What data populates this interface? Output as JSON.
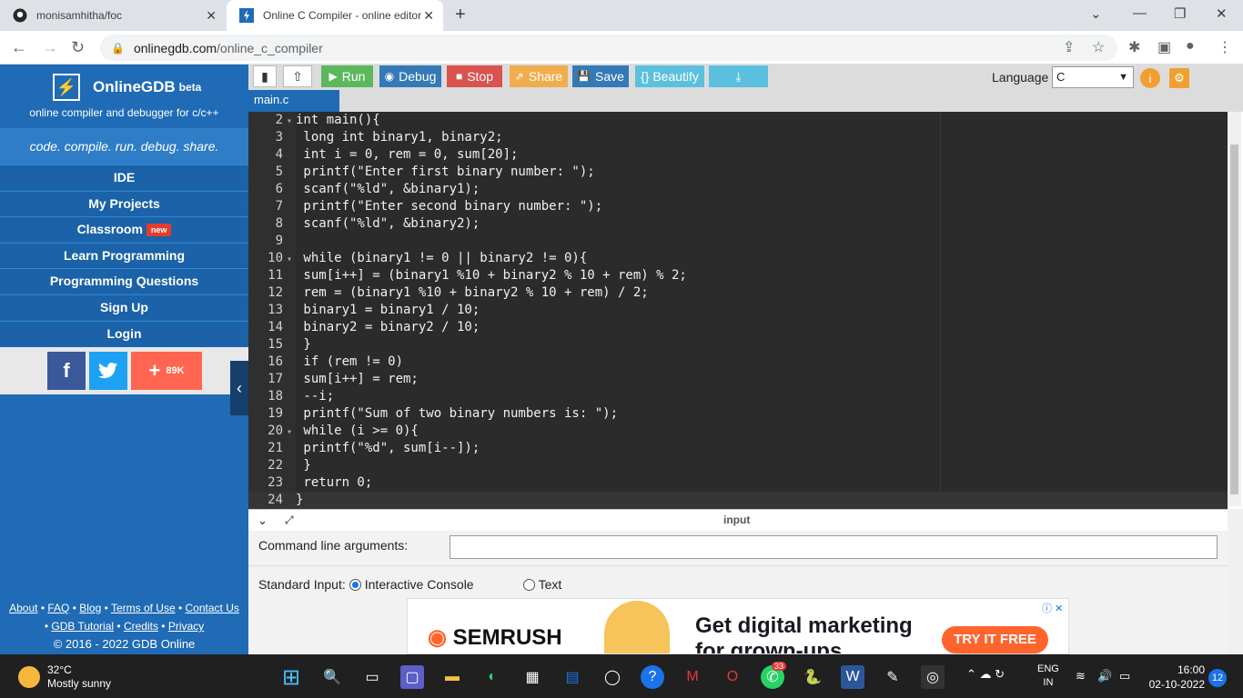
{
  "browser": {
    "tabs": [
      {
        "title": "monisamhitha/foc",
        "icon": "github-icon"
      },
      {
        "title": "Online C Compiler - online editor",
        "icon": "onlinegdb-icon"
      }
    ],
    "address": {
      "domain": "onlinegdb.com",
      "path": "/online_c_compiler"
    }
  },
  "sidebar": {
    "logo_name": "OnlineGDB",
    "logo_sup": "beta",
    "subtitle": "online compiler and debugger for c/c++",
    "tagline": "code. compile. run. debug. share.",
    "nav": [
      {
        "label": "IDE"
      },
      {
        "label": "My Projects"
      },
      {
        "label": "Classroom",
        "badge": "new"
      },
      {
        "label": "Learn Programming"
      },
      {
        "label": "Programming Questions"
      },
      {
        "label": "Sign Up"
      },
      {
        "label": "Login"
      }
    ],
    "social": {
      "facebook": "f",
      "twitter": "t",
      "share_count": "89K"
    },
    "footer": {
      "links1": [
        "About",
        "FAQ",
        "Blog",
        "Terms of Use",
        "Contact Us"
      ],
      "links2": [
        "GDB Tutorial",
        "Credits",
        "Privacy"
      ],
      "copyright": "© 2016 - 2022 GDB Online"
    }
  },
  "toolbar": {
    "run": "Run",
    "debug": "Debug",
    "stop": "Stop",
    "share": "Share",
    "save": "Save",
    "beautify": "{} Beautify",
    "language_label": "Language",
    "language_value": "C",
    "colors": {
      "run": "#5cb85c",
      "debug": "#337ab7",
      "stop": "#d9534f",
      "share": "#f0ad4e",
      "save": "#337ab7",
      "beautify": "#5bc0de",
      "download": "#5bc0de"
    }
  },
  "file_tab": "main.c",
  "code_lines": [
    {
      "n": "2",
      "fold": true,
      "text": "int main(){"
    },
    {
      "n": "3",
      "text": " long int binary1, binary2;"
    },
    {
      "n": "4",
      "text": " int i = 0, rem = 0, sum[20];"
    },
    {
      "n": "5",
      "text": " printf(\"Enter first binary number: \");"
    },
    {
      "n": "6",
      "text": " scanf(\"%ld\", &binary1);"
    },
    {
      "n": "7",
      "text": " printf(\"Enter second binary number: \");"
    },
    {
      "n": "8",
      "text": " scanf(\"%ld\", &binary2);"
    },
    {
      "n": "9",
      "text": ""
    },
    {
      "n": "10",
      "fold": true,
      "text": " while (binary1 != 0 || binary2 != 0){"
    },
    {
      "n": "11",
      "text": " sum[i++] = (binary1 %10 + binary2 % 10 + rem) % 2;"
    },
    {
      "n": "12",
      "text": " rem = (binary1 %10 + binary2 % 10 + rem) / 2;"
    },
    {
      "n": "13",
      "text": " binary1 = binary1 / 10;"
    },
    {
      "n": "14",
      "text": " binary2 = binary2 / 10;"
    },
    {
      "n": "15",
      "text": " }"
    },
    {
      "n": "16",
      "text": " if (rem != 0)"
    },
    {
      "n": "17",
      "text": " sum[i++] = rem;"
    },
    {
      "n": "18",
      "text": " --i;"
    },
    {
      "n": "19",
      "text": " printf(\"Sum of two binary numbers is: \");"
    },
    {
      "n": "20",
      "fold": true,
      "text": " while (i >= 0){"
    },
    {
      "n": "21",
      "text": " printf(\"%d\", sum[i--]);"
    },
    {
      "n": "22",
      "text": " }"
    },
    {
      "n": "23",
      "text": " return 0;"
    },
    {
      "n": "24",
      "text": "}"
    }
  ],
  "io": {
    "header": "input",
    "cla_label": "Command line arguments:",
    "stdin_label": "Standard Input:",
    "opt_console": "Interactive Console",
    "opt_text": "Text"
  },
  "ad": {
    "brand": "SEMRUSH",
    "headline1": "Get digital marketing",
    "headline2": "for grown-ups",
    "cta": "TRY IT FREE"
  },
  "taskbar": {
    "temp": "32°C",
    "weather": "Mostly sunny",
    "lang1": "ENG",
    "lang2": "IN",
    "time": "16:00",
    "date": "02-10-2022",
    "notifications": "12",
    "whatsapp_badge": "33"
  }
}
